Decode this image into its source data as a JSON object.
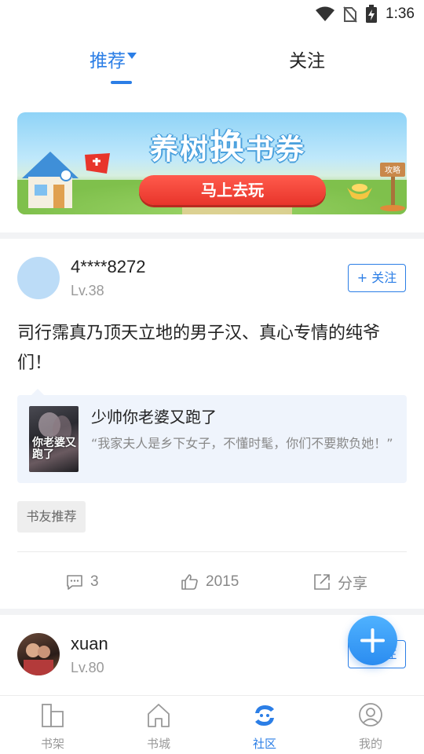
{
  "status_bar": {
    "time": "1:36",
    "icons": [
      "wifi-icon",
      "no-sim-icon",
      "battery-charging-icon"
    ]
  },
  "top_tabs": [
    {
      "label": "推荐",
      "active": true,
      "has_dropdown": true
    },
    {
      "label": "关注",
      "active": false
    }
  ],
  "banner": {
    "title_left": "养树",
    "title_big": "换",
    "title_right": "书券",
    "cta": "马上去玩",
    "sign": "攻略"
  },
  "posts": [
    {
      "username": "4****8272",
      "level": "Lv.38",
      "follow_label": "+ 关注",
      "text": "司行霈真乃顶天立地的男子汉、真心专情的纯爷们！",
      "book": {
        "title": "少帅你老婆又跑了",
        "cover_text": "你老婆又跑了",
        "quote": "“我家夫人是乡下女子，不懂时髦，你们不要欺负她！”"
      },
      "tag": "书友推荐",
      "actions": {
        "comments": "3",
        "likes": "2015",
        "share": "分享"
      }
    },
    {
      "username": "xuan",
      "level": "Lv.80",
      "follow_label": "+ 关注"
    }
  ],
  "fab": {
    "icon": "plus-icon"
  },
  "bottom_nav": [
    {
      "label": "书架",
      "icon": "bookshelf-icon",
      "active": false
    },
    {
      "label": "书城",
      "icon": "home-icon",
      "active": false
    },
    {
      "label": "社区",
      "icon": "community-icon",
      "active": true
    },
    {
      "label": "我的",
      "icon": "profile-icon",
      "active": false
    }
  ],
  "colors": {
    "accent": "#2b7ee6",
    "cta": "#e8352b",
    "card_bg": "#eff4fc"
  }
}
